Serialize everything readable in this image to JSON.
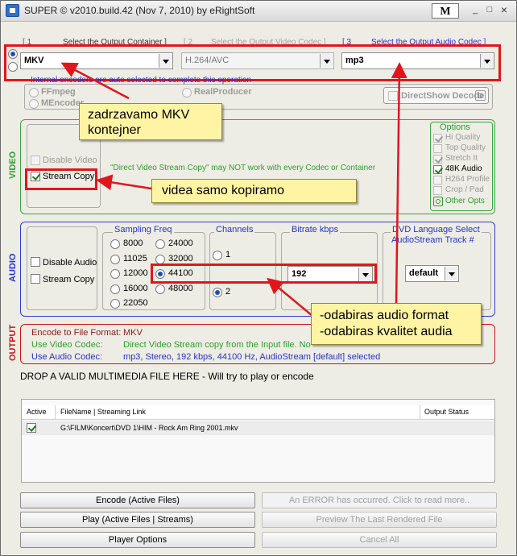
{
  "window": {
    "title": "SUPER © v2010.build.42 (Nov 7, 2010) by eRightSoft",
    "m_label": "M"
  },
  "titlebar_buttons": {
    "minimize": "_",
    "maximize": "□",
    "close": "×"
  },
  "headers": {
    "container_num": "[ 1",
    "container": "Select the Output Container ]",
    "video_codec_num": "[ 2",
    "video_codec": "Select the Output Video Codec ]",
    "audio_codec_num": "[ 3",
    "audio_codec": "Select the Output Audio Codec ]"
  },
  "selects": {
    "container": "MKV",
    "video_codec": "H.264/AVC",
    "audio_codec": "mp3"
  },
  "encoders": {
    "note": "Internal encoders are auto selected to complete this operation",
    "ffmpeg": "FFmpeg",
    "mencoder": "MEncoder",
    "realproducer": "RealProducer",
    "directshow": "DirectShow Decode",
    "directshow_key": "D"
  },
  "video": {
    "side_label": "VIDEO",
    "disable": "Disable Video",
    "stream_copy": "Stream Copy",
    "warning": "\"Direct Video Stream Copy\" may NOT work with every Codec or Container"
  },
  "options": {
    "title": "Options",
    "items": [
      {
        "label": "Hi Quality",
        "checked": true,
        "disabled": true
      },
      {
        "label": "Top Quality",
        "checked": false,
        "disabled": true
      },
      {
        "label": "Stretch It",
        "checked": true,
        "disabled": true
      },
      {
        "label": "48K Audio",
        "checked": true,
        "disabled": false
      },
      {
        "label": "H264 Profile",
        "checked": false,
        "disabled": true
      },
      {
        "label": "Crop / Pad",
        "checked": false,
        "disabled": true
      }
    ],
    "other": "Other Opts"
  },
  "audio": {
    "side_label": "AUDIO",
    "disable": "Disable Audio",
    "stream_copy": "Stream Copy",
    "sampling_title": "Sampling Freq",
    "sampling_col1": [
      "8000",
      "11025",
      "12000",
      "16000",
      "22050"
    ],
    "sampling_col2": [
      "24000",
      "32000",
      "44100",
      "48000"
    ],
    "selected_freq": "44100",
    "channels_title": "Channels",
    "channel_1": "1",
    "channel_2": "2",
    "bitrate_title": "Bitrate  kbps",
    "bitrate": "192",
    "dvd_title1": "DVD Language Select",
    "dvd_title2": "AudioStream  Track #",
    "dvd_value": "default"
  },
  "output": {
    "side_label": "OUTPUT",
    "format_label": "Encode to File Format:",
    "format_value": "MKV",
    "video_label": "Use Video Codec:",
    "video_value": "Direct Video Stream copy  from the Input file. No",
    "audio_label": "Use Audio Codec:",
    "audio_value": "mp3,   Stereo,   192 kbps,   44100 Hz,  AudioStream [default] selected"
  },
  "drop_text": "DROP A VALID MULTIMEDIA FILE HERE - Will try to play or encode",
  "files": {
    "columns": [
      "Active",
      "FileName  |  Streaming Link",
      "Output Status"
    ],
    "rows": [
      {
        "active": true,
        "file": "G:\\FILM\\Koncert\\DVD 1\\HIM - Rock Am Ring 2001.mkv",
        "status": ""
      }
    ]
  },
  "buttons": {
    "encode": "Encode (Active Files)",
    "error": "An ERROR has occurred. Click to read more..",
    "play": "Play (Active Files | Streams)",
    "preview": "Preview The Last Rendered File",
    "player_options": "Player Options",
    "cancel_all": "Cancel All"
  },
  "annotations": {
    "mkv_line1": "zadrzavamo MKV",
    "mkv_line2": "kontejner",
    "video": "videa samo kopiramo",
    "audio_line1": "-odabiras audio format",
    "audio_line2": "-odabiras kvalitet audia"
  },
  "colors": {
    "annotation_red": "#e0161c",
    "callout_bg": "#fff4a3",
    "video_green": "#2e9e2e",
    "audio_blue": "#2233cc",
    "output_red": "#c7151b"
  }
}
